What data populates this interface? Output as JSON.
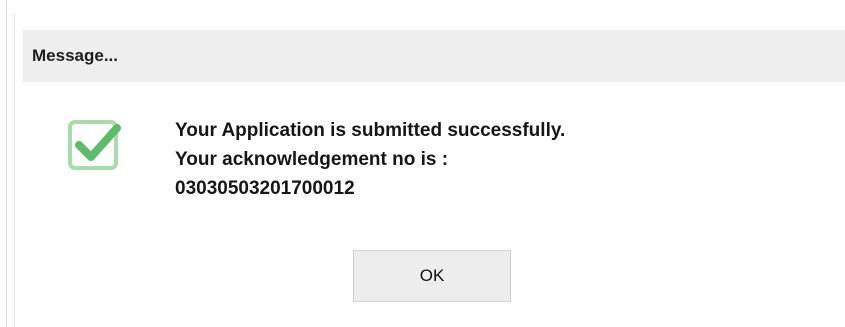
{
  "dialog": {
    "title": "Message...",
    "icon": "check-icon",
    "message_lines": [
      "Your Application is submitted successfully.",
      "Your acknowledgement no is :",
      "03030503201700012"
    ],
    "ok_label": "OK"
  },
  "colors": {
    "check_green": "#6fc27a",
    "titlebar_bg": "#eeeeee",
    "button_bg": "#ededed"
  }
}
